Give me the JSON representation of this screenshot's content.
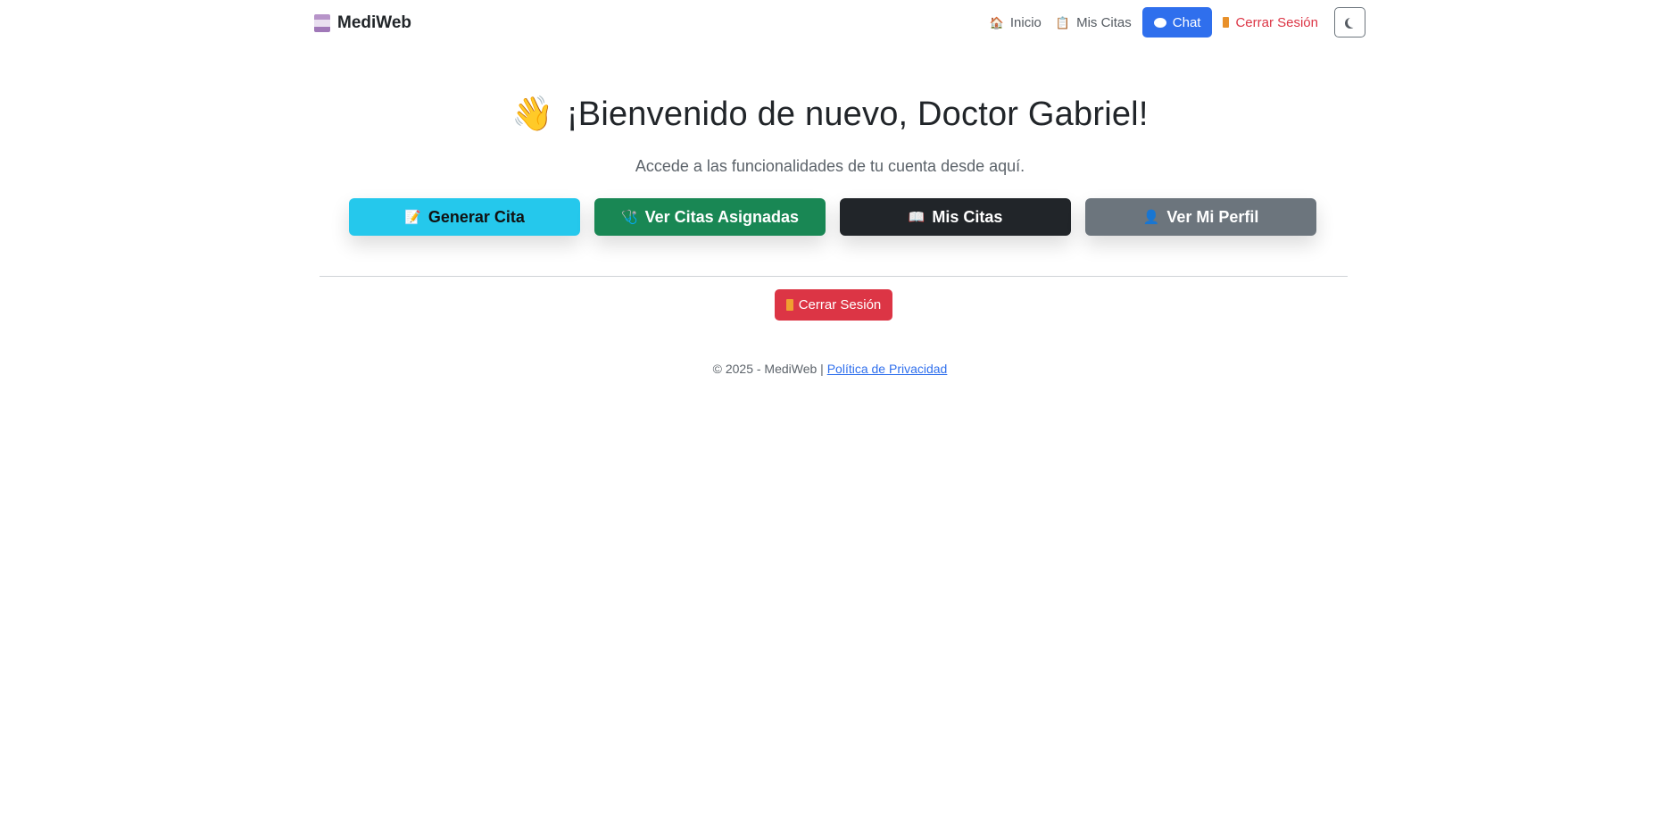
{
  "navbar": {
    "brand": "MediWeb",
    "links": [
      {
        "icon": "🏠",
        "label": "Inicio"
      },
      {
        "icon": "📋",
        "label": "Mis Citas"
      }
    ],
    "chat_label": "Chat",
    "logout_label": "Cerrar Sesión"
  },
  "hero": {
    "wave": "👋",
    "title": "¡Bienvenido de nuevo, Doctor Gabriel!",
    "subtitle": "Accede a las funcionalidades de tu cuenta desde aquí."
  },
  "actions": [
    {
      "icon": "📝",
      "label": "Generar Cita",
      "color": "#25c8ec"
    },
    {
      "icon": "🩺",
      "label": "Ver Citas Asignadas",
      "color": "#198754"
    },
    {
      "icon": "📖",
      "label": "Mis Citas",
      "color": "#212529"
    },
    {
      "icon": "👤",
      "label": "Ver Mi Perfil",
      "color": "#6c757d"
    }
  ],
  "logout_button": "Cerrar Sesión",
  "footer": {
    "text": "© 2025 - MediWeb |",
    "link": "Política de Privacidad"
  }
}
